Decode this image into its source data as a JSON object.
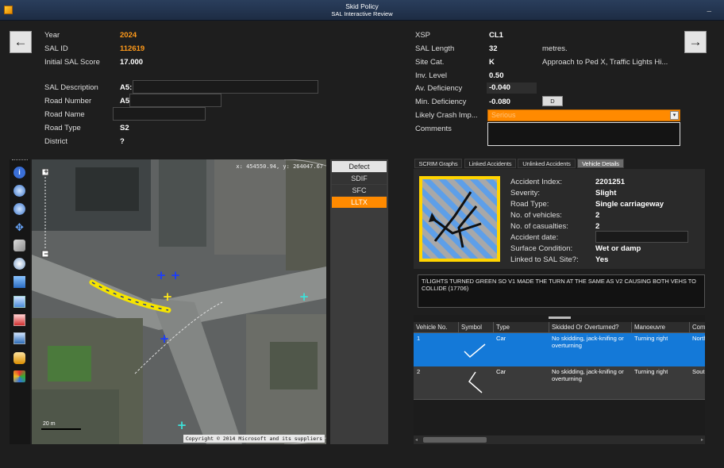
{
  "window": {
    "title": "Skid Policy",
    "subtitle": "SAL Interactive Review",
    "controls": "–"
  },
  "nav": {
    "prev": "←",
    "next": "→"
  },
  "left": {
    "year_label": "Year",
    "year": "2024",
    "sal_id_label": "SAL ID",
    "sal_id": "112619",
    "initial_label": "Initial SAL Score",
    "initial": "17.000",
    "desc_label": "SAL Description",
    "desc_prefix": "A5:",
    "road_no_label": "Road Number",
    "road_no_prefix": "A5",
    "road_name_label": "Road Name",
    "road_type_label": "Road Type",
    "road_type": "S2",
    "district_label": "District",
    "district": "?"
  },
  "right": {
    "xsp_label": "XSP",
    "xsp": "CL1",
    "length_label": "SAL Length",
    "length": "32",
    "length_unit": "metres.",
    "site_label": "Site Cat.",
    "site": "K",
    "site_desc": "Approach to Ped X, Traffic Lights  Hi...",
    "inv_label": "Inv. Level",
    "inv": "0.50",
    "avdef_label": "Av. Deficiency",
    "avdef": "-0.040",
    "mindef_label": "Min. Deficiency",
    "mindef": "-0.080",
    "mindef_btn": "D",
    "crash_label": "Likely Crash Imp...",
    "crash": "Serious",
    "comments_label": "Comments"
  },
  "map": {
    "coords": "x: 454550.94,  y: 264047.67",
    "copyright": "Copyright © 2014 Microsoft and its suppliers",
    "scale": "20 m"
  },
  "defects": {
    "header": "Defect",
    "items": [
      "SDIF",
      "SFC",
      "LLTX"
    ],
    "selected": 2
  },
  "tabs": [
    "SCRIM Graphs",
    "Linked Accidents",
    "Unlinked Accidents",
    "Vehicle Details"
  ],
  "accident": {
    "index_label": "Accident Index:",
    "index": "2201251",
    "severity_label": "Severity:",
    "severity": "Slight",
    "road_type_label": "Road Type:",
    "road_type": "Single carriageway",
    "vehicles_label": "No. of vehicles:",
    "vehicles": "2",
    "casualties_label": "No. of casualties:",
    "casualties": "2",
    "date_label": "Accident date:",
    "surface_label": "Surface Condition:",
    "surface": "Wet or damp",
    "linked_label": "Linked to SAL Site?:",
    "linked": "Yes",
    "narrative": "T/LIGHTS TURNED GREEN SO V1 MADE THE TURN AT THE SAME AS V2 CAUSING BOTH VEHS TO COLLIDE (17706)"
  },
  "grid": {
    "columns": [
      "Vehicle No.",
      "Symbol",
      "Type",
      "Skidded Or Overturned?",
      "Manoeuvre",
      "Comi"
    ],
    "rows": [
      {
        "no": "1",
        "type": "Car",
        "skid": "No skidding, jack-knifing or overturning",
        "man": "Turning right",
        "comp": "North"
      },
      {
        "no": "2",
        "type": "Car",
        "skid": "No skidding, jack-knifing or overturning",
        "man": "Turning right",
        "comp": "South"
      }
    ]
  },
  "colors": {
    "accent": "#ff9a1a",
    "selection": "#1479d8",
    "symbol_border": "#ffd400",
    "symbol_stripe": "#5e9fe8"
  }
}
